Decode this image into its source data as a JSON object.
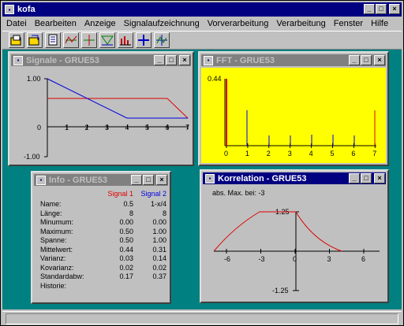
{
  "app": {
    "title": "kofa"
  },
  "menu": [
    "Datei",
    "Bearbeiten",
    "Anzeige",
    "Signalaufzeichnung",
    "Vorverarbeitung",
    "Verarbeitung",
    "Fenster",
    "Hilfe"
  ],
  "toolbar_icons": [
    "open-folder-icon",
    "convert-icon",
    "document-icon",
    "signal-chart-icon",
    "cross-chart-icon",
    "filter-chart-icon",
    "bar-chart-icon",
    "crosshair-icon",
    "grid-chart-icon"
  ],
  "window_buttons": {
    "minimize": "_",
    "maximize": "□",
    "close": "×"
  },
  "signale": {
    "title": "Signale - GRUE53",
    "y_top": "1.00",
    "y_zero": "0",
    "y_bottom": "-1.00",
    "x_ticks": [
      "1",
      "2",
      "3",
      "4",
      "5",
      "6",
      "7"
    ],
    "colors": {
      "signal1": "#e00000",
      "signal2": "#0000e0"
    }
  },
  "fft": {
    "title": "FFT - GRUE53",
    "y_top": "0.44",
    "x_ticks": [
      "0",
      "1",
      "2",
      "3",
      "4",
      "5",
      "6",
      "7"
    ],
    "background": "#ffff00"
  },
  "info": {
    "title": "Info - GRUE53",
    "col1": "Signal 1",
    "col2": "Signal 2",
    "rows": [
      {
        "label": "Name:",
        "v1": "0.5",
        "v2": "1-x/4"
      },
      {
        "label": "Länge:",
        "v1": "8",
        "v2": "8"
      },
      {
        "label": "Minumum:",
        "v1": "0.00",
        "v2": "0.00"
      },
      {
        "label": "Maximum:",
        "v1": "0.50",
        "v2": "1.00"
      },
      {
        "label": "Spanne:",
        "v1": "0.50",
        "v2": "1.00"
      },
      {
        "label": "Mittelwert:",
        "v1": "0.44",
        "v2": "0.31"
      },
      {
        "label": "Varianz:",
        "v1": "0.03",
        "v2": "0.14"
      },
      {
        "label": "Kovarianz:",
        "v1": "0.02",
        "v2": "0.02"
      },
      {
        "label": "Standardabw:",
        "v1": "0.17",
        "v2": "0.37"
      },
      {
        "label": "Historie:",
        "v1": "",
        "v2": ""
      }
    ]
  },
  "korrelation": {
    "title": "Korrelation - GRUE53",
    "max_label": "abs. Max. bei: -3",
    "y_top": "1.25",
    "y_bottom": "-1.25",
    "x_ticks": [
      "-6",
      "-3",
      "0",
      "3",
      "6"
    ]
  },
  "status": {
    "text": ""
  }
}
